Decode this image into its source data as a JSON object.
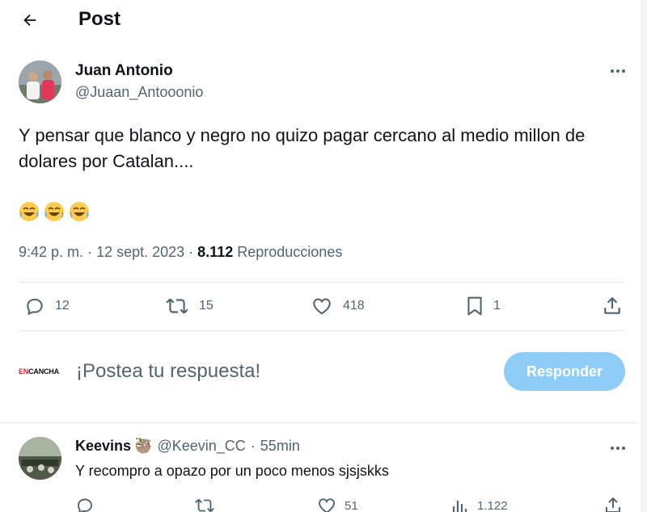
{
  "header": {
    "title": "Post"
  },
  "post": {
    "author_name": "Juan Antonio",
    "author_handle": "@Juaan_Antooonio",
    "text": "Y pensar que blanco y negro no quizo pagar cercano al medio millon de dolares por Catalan....",
    "emojis": [
      "😂",
      "😂",
      "😂"
    ],
    "time": "9:42 p. m.",
    "date": "12 sept. 2023",
    "views_count": "8.112",
    "views_label": "Reproducciones",
    "stats": {
      "replies": "12",
      "reposts": "15",
      "likes": "418",
      "bookmarks": "1"
    }
  },
  "composer": {
    "logo_prefix": "EN",
    "logo_suffix": "CANCHA",
    "placeholder": "¡Postea tu respuesta!",
    "button_label": "Responder"
  },
  "reply": {
    "name": "Keevins",
    "badge_emoji": "🦥",
    "handle": "@Keevin_CC",
    "time": "55min",
    "text": "Y  recompro a opazo por un poco menos sjsjskks",
    "stats": {
      "likes": "51",
      "views": "1.122"
    }
  },
  "icons": {
    "back": "arrow-left-icon",
    "more": "more-horizontal-icon",
    "reply": "comment-icon",
    "repost": "repost-icon",
    "like": "heart-icon",
    "bookmark": "bookmark-icon",
    "share": "share-icon",
    "views": "analytics-icon"
  },
  "colors": {
    "text_primary": "#0f1419",
    "text_secondary": "#536471",
    "divider": "#e3e8ec",
    "button_disabled": "#8ecdf8",
    "logo_red": "#d9232d"
  }
}
